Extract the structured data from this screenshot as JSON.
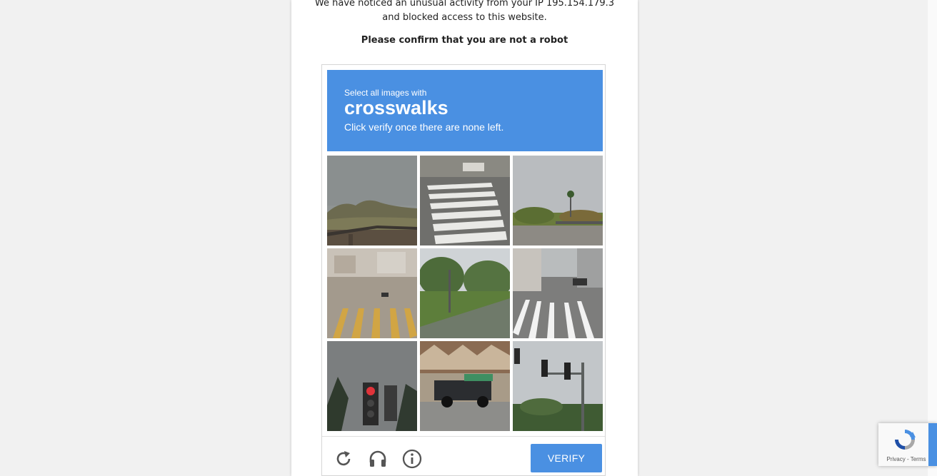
{
  "notice": {
    "line1": "We have noticed an unusual activity from your IP 195.154.179.3",
    "line2": "and blocked access to this website.",
    "confirm": "Please confirm that you are not a robot"
  },
  "captcha": {
    "instruction_small": "Select all images with",
    "target": "crosswalks",
    "instruction_sub": "Click verify once there are none left.",
    "verify_label": "VERIFY",
    "accent_color": "#4a90e2",
    "tiles": [
      {
        "name": "tile-overpass-hills"
      },
      {
        "name": "tile-crosswalk-closeup"
      },
      {
        "name": "tile-palm-tree-road"
      },
      {
        "name": "tile-yellow-crosswalk"
      },
      {
        "name": "tile-trees-median"
      },
      {
        "name": "tile-street-crosswalk"
      },
      {
        "name": "tile-traffic-light-red"
      },
      {
        "name": "tile-pickup-truck"
      },
      {
        "name": "tile-traffic-signals-pole"
      }
    ],
    "icons": [
      "reload-icon",
      "audio-headphones-icon",
      "info-icon"
    ]
  },
  "badge": {
    "terms": "Privacy - Terms"
  }
}
